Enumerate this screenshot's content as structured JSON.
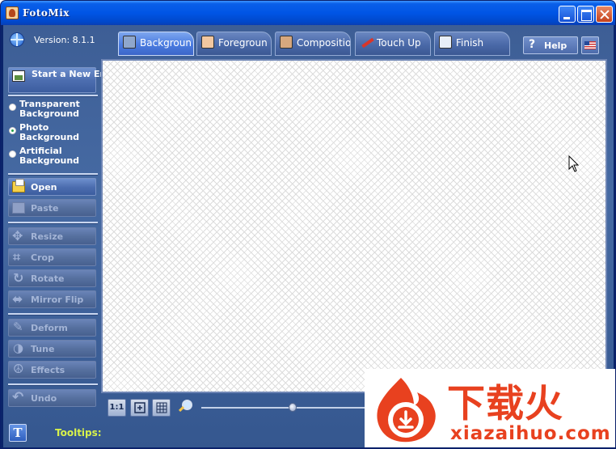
{
  "window": {
    "title": "FotoMix"
  },
  "version": {
    "label": "Version: 8.1.1"
  },
  "tabs": [
    {
      "label": "Backgroun",
      "active": true
    },
    {
      "label": "Foregroun",
      "active": false
    },
    {
      "label": "Compositio",
      "active": false
    },
    {
      "label": "Touch Up",
      "active": false
    },
    {
      "label": "Finish",
      "active": false
    }
  ],
  "help": {
    "label": "Help"
  },
  "sidebar": {
    "new_project": "Start a New Empty Project",
    "radios": [
      {
        "label": "Transparent Background",
        "checked": false
      },
      {
        "label": "Photo Background",
        "checked": true
      },
      {
        "label": "Artificial Background",
        "checked": false
      }
    ],
    "buttons": {
      "open": "Open",
      "paste": "Paste",
      "resize": "Resize",
      "crop": "Crop",
      "rotate": "Rotate",
      "mirror": "Mirror Flip",
      "deform": "Deform",
      "tune": "Tune",
      "effects": "Effects",
      "undo": "Undo"
    }
  },
  "bottom_tools": {
    "actual_size": "1:1",
    "zoom_level": 0.54
  },
  "status": {
    "tooltips_label": "Tooltips:",
    "tips_icon": "T"
  },
  "watermark": {
    "title": "下载火",
    "domain": "xiazaihuo.com",
    "color": "#e8411f"
  }
}
